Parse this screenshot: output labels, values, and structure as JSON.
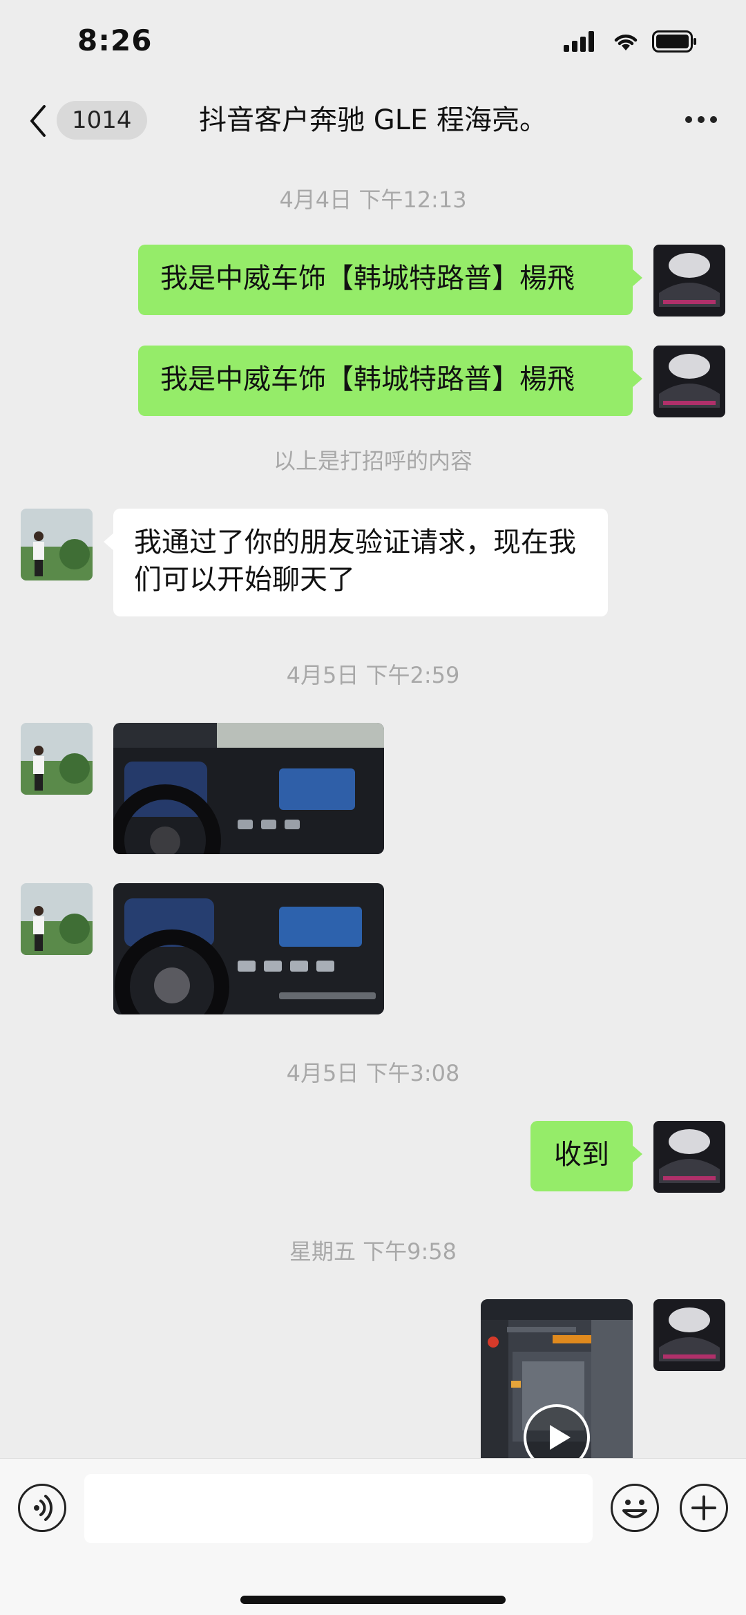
{
  "status_bar": {
    "time": "8:26"
  },
  "header": {
    "unread_count": "1014",
    "title": "抖音客户奔驰 GLE 程海亮。"
  },
  "messages": {
    "ts1": "4月4日 下午12:13",
    "me1": "我是中威车饰【韩城特路普】楊飛",
    "me2": "我是中威车饰【韩城特路普】楊飛",
    "system_note": "以上是打招呼的内容",
    "them1": "我通过了你的朋友验证请求，现在我们可以开始聊天了",
    "ts2": "4月5日 下午2:59",
    "ts3": "4月5日 下午3:08",
    "me3": "收到",
    "ts4": "星期五 下午9:58"
  },
  "input": {
    "placeholder": ""
  },
  "icons": {
    "back": "chevron-left-icon",
    "more": "more-icon",
    "voice": "voice-icon",
    "emoji": "emoji-icon",
    "plus": "plus-icon",
    "play": "play-icon"
  },
  "colors": {
    "sent_bubble": "#95ec69",
    "received_bubble": "#ffffff",
    "background": "#ededed"
  }
}
